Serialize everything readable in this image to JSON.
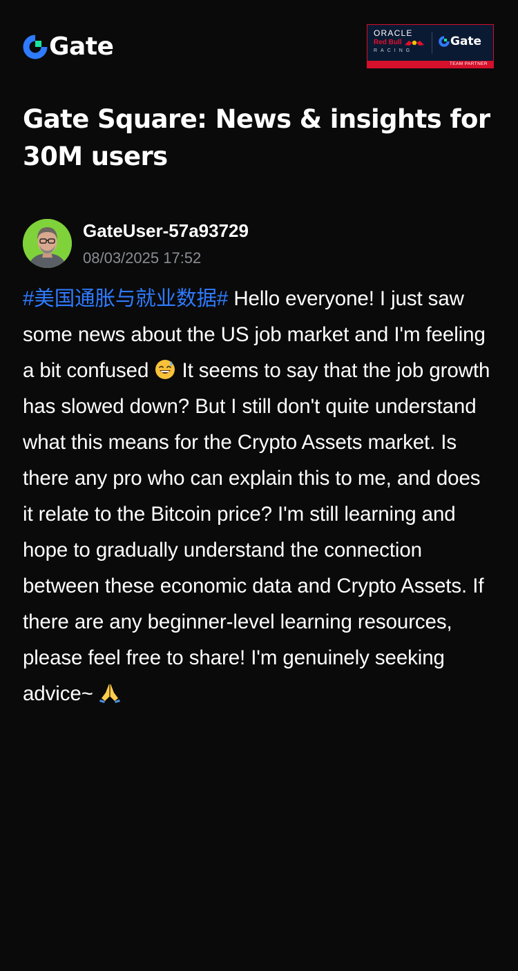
{
  "header": {
    "logo_text": "Gate",
    "partner": {
      "oracle_text": "ORACLE",
      "redbull_text": "Red Bull",
      "racing_text": "RACING",
      "gate_text": "Gate",
      "badge_text": "TEAM PARTNER"
    }
  },
  "page_title": "Gate Square: News & insights for 30M users",
  "author": {
    "name": "GateUser-57a93729",
    "timestamp": "08/03/2025 17:52"
  },
  "post": {
    "hashtag": "#美国通胀与就业数据#",
    "text_1": " Hello everyone! I just saw some news about the US job market and I'm feeling a bit confused ",
    "emoji_1": "sweat-smile-emoji",
    "text_2": " It seems to say that the job growth has slowed down? But I still don't quite understand what this means for the Crypto Assets market. Is there any pro who can explain this to me, and does it relate to the Bitcoin price? I'm still learning and hope to gradually understand the connection between these economic data and Crypto Assets. If there are any beginner-level learning resources, please feel free to share! I'm genuinely seeking advice~ ",
    "emoji_2": "folded-hands-emoji"
  },
  "colors": {
    "background": "#0a0a0b",
    "brand_blue": "#2f7bff",
    "brand_green": "#17e5a1",
    "hashtag": "#2f7bff",
    "muted_text": "#8a8d93",
    "partner_red": "#d4102b",
    "partner_navy": "#0b1a33"
  }
}
